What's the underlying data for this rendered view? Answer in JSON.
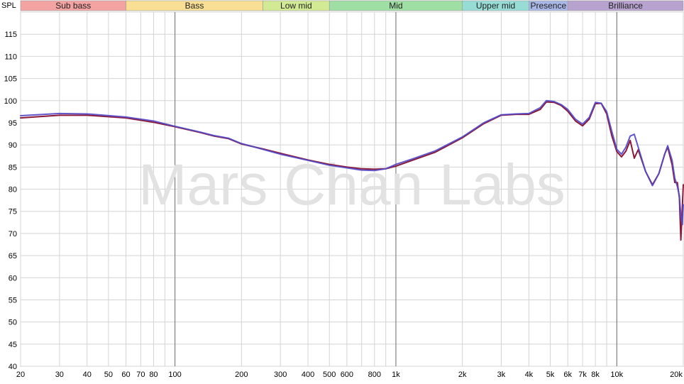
{
  "chart_data": {
    "type": "line",
    "title": "",
    "ylabel": "SPL",
    "xlabel": "",
    "x_scale": "log",
    "xlim": [
      20,
      20000
    ],
    "ylim": [
      40,
      120
    ],
    "grid": true,
    "watermark": "Mars Chan Labs",
    "y_ticks": [
      40,
      45,
      50,
      55,
      60,
      65,
      70,
      75,
      80,
      85,
      90,
      95,
      100,
      105,
      110,
      115
    ],
    "x_ticks": [
      {
        "value": 20,
        "label": "20"
      },
      {
        "value": 30,
        "label": "30"
      },
      {
        "value": 40,
        "label": "40"
      },
      {
        "value": 50,
        "label": "50"
      },
      {
        "value": 60,
        "label": "60"
      },
      {
        "value": 70,
        "label": "70"
      },
      {
        "value": 80,
        "label": "80"
      },
      {
        "value": 100,
        "label": "100"
      },
      {
        "value": 200,
        "label": "200"
      },
      {
        "value": 300,
        "label": "300"
      },
      {
        "value": 400,
        "label": "400"
      },
      {
        "value": 500,
        "label": "500"
      },
      {
        "value": 600,
        "label": "600"
      },
      {
        "value": 800,
        "label": "800"
      },
      {
        "value": 1000,
        "label": "1k"
      },
      {
        "value": 2000,
        "label": "2k"
      },
      {
        "value": 3000,
        "label": "3k"
      },
      {
        "value": 4000,
        "label": "4k"
      },
      {
        "value": 5000,
        "label": "5k"
      },
      {
        "value": 6000,
        "label": "6k"
      },
      {
        "value": 7000,
        "label": "7k"
      },
      {
        "value": 8000,
        "label": "8k"
      },
      {
        "value": 10000,
        "label": "10k"
      },
      {
        "value": 20000,
        "label": "20k"
      }
    ],
    "bands": [
      {
        "label": "Sub bass",
        "from": 20,
        "to": 60,
        "color": "#f4a3a3"
      },
      {
        "label": "Bass",
        "from": 60,
        "to": 250,
        "color": "#f9df93"
      },
      {
        "label": "Low mid",
        "from": 250,
        "to": 500,
        "color": "#d3ea94"
      },
      {
        "label": "Mid",
        "from": 500,
        "to": 2000,
        "color": "#9fdfa4"
      },
      {
        "label": "Upper mid",
        "from": 2000,
        "to": 4000,
        "color": "#98dcd6"
      },
      {
        "label": "Presence",
        "from": 4000,
        "to": 6000,
        "color": "#a9b7e6"
      },
      {
        "label": "Brilliance",
        "from": 6000,
        "to": 20000,
        "color": "#b8a2d0"
      }
    ],
    "series": [
      {
        "color": "#8b1a3a",
        "points": [
          [
            20,
            96.1
          ],
          [
            30,
            96.7
          ],
          [
            40,
            96.7
          ],
          [
            60,
            96.1
          ],
          [
            80,
            95.1
          ],
          [
            100,
            94.1
          ],
          [
            130,
            92.8
          ],
          [
            150,
            92.0
          ],
          [
            175,
            91.4
          ],
          [
            200,
            90.2
          ],
          [
            250,
            89.1
          ],
          [
            300,
            88.1
          ],
          [
            400,
            86.6
          ],
          [
            500,
            85.6
          ],
          [
            600,
            85.0
          ],
          [
            700,
            84.6
          ],
          [
            800,
            84.5
          ],
          [
            900,
            84.6
          ],
          [
            1000,
            85.2
          ],
          [
            1200,
            86.6
          ],
          [
            1500,
            88.3
          ],
          [
            2000,
            91.6
          ],
          [
            2500,
            94.8
          ],
          [
            3000,
            96.7
          ],
          [
            3500,
            96.9
          ],
          [
            4000,
            96.9
          ],
          [
            4500,
            98.0
          ],
          [
            4800,
            99.7
          ],
          [
            5200,
            99.6
          ],
          [
            5600,
            98.9
          ],
          [
            6000,
            97.6
          ],
          [
            6500,
            95.4
          ],
          [
            7000,
            94.3
          ],
          [
            7500,
            95.8
          ],
          [
            8000,
            99.3
          ],
          [
            8500,
            99.4
          ],
          [
            9000,
            97.0
          ],
          [
            9500,
            92.0
          ],
          [
            10000,
            88.5
          ],
          [
            10500,
            87.3
          ],
          [
            11000,
            88.6
          ],
          [
            11500,
            91.0
          ],
          [
            12000,
            87.0
          ],
          [
            12500,
            88.9
          ],
          [
            13500,
            84.0
          ],
          [
            14500,
            81.0
          ],
          [
            15500,
            83.5
          ],
          [
            16500,
            88.0
          ],
          [
            17000,
            89.5
          ],
          [
            17800,
            85.5
          ],
          [
            18300,
            81.5
          ],
          [
            18800,
            81.5
          ],
          [
            19200,
            78.0
          ],
          [
            19500,
            68.5
          ],
          [
            19800,
            76.0
          ],
          [
            20000,
            81.0
          ]
        ]
      },
      {
        "color": "#5548c4",
        "points": [
          [
            20,
            96.6
          ],
          [
            30,
            97.1
          ],
          [
            40,
            97.0
          ],
          [
            60,
            96.3
          ],
          [
            80,
            95.4
          ],
          [
            100,
            94.2
          ],
          [
            130,
            92.9
          ],
          [
            150,
            92.1
          ],
          [
            175,
            91.5
          ],
          [
            200,
            90.3
          ],
          [
            250,
            89.0
          ],
          [
            300,
            87.9
          ],
          [
            400,
            86.5
          ],
          [
            500,
            85.4
          ],
          [
            600,
            84.8
          ],
          [
            700,
            84.3
          ],
          [
            800,
            84.2
          ],
          [
            900,
            84.6
          ],
          [
            1000,
            85.6
          ],
          [
            1200,
            86.9
          ],
          [
            1500,
            88.6
          ],
          [
            2000,
            91.8
          ],
          [
            2500,
            95.0
          ],
          [
            3000,
            96.8
          ],
          [
            3500,
            97.0
          ],
          [
            4000,
            97.1
          ],
          [
            4500,
            98.4
          ],
          [
            4800,
            100.0
          ],
          [
            5200,
            99.8
          ],
          [
            5600,
            99.1
          ],
          [
            6000,
            98.0
          ],
          [
            6500,
            95.8
          ],
          [
            7000,
            94.7
          ],
          [
            7500,
            96.2
          ],
          [
            8000,
            99.6
          ],
          [
            8500,
            99.4
          ],
          [
            9000,
            97.5
          ],
          [
            9500,
            93.0
          ],
          [
            10000,
            89.0
          ],
          [
            10500,
            87.9
          ],
          [
            11000,
            89.5
          ],
          [
            11500,
            92.0
          ],
          [
            12000,
            92.4
          ],
          [
            12500,
            89.5
          ],
          [
            13500,
            84.0
          ],
          [
            14500,
            80.8
          ],
          [
            15500,
            83.5
          ],
          [
            16500,
            88.0
          ],
          [
            17000,
            89.8
          ],
          [
            17800,
            86.5
          ],
          [
            18300,
            82.5
          ],
          [
            18800,
            80.6
          ],
          [
            19200,
            78.5
          ],
          [
            19500,
            74.0
          ],
          [
            19800,
            72.0
          ],
          [
            20000,
            76.5
          ]
        ]
      }
    ]
  }
}
